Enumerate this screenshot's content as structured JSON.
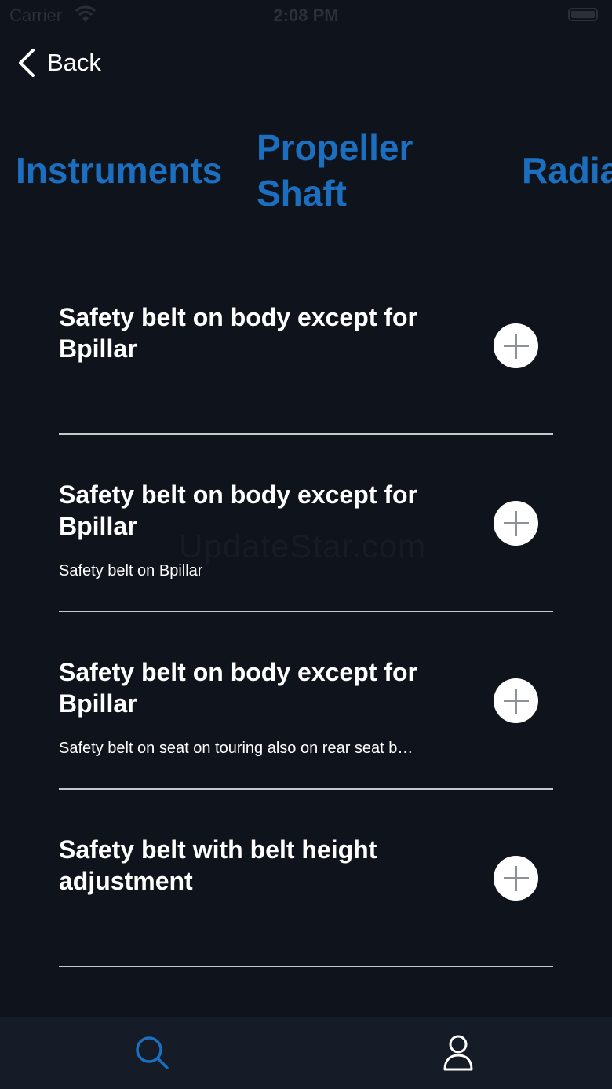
{
  "status_bar": {
    "carrier": "Carrier",
    "time": "2:08 PM"
  },
  "nav": {
    "back_label": "Back"
  },
  "categories": [
    {
      "label": "Instruments"
    },
    {
      "label": "Propeller Shaft"
    },
    {
      "label": "Radia"
    }
  ],
  "items": [
    {
      "title": "Safety belt on body except for Bpillar",
      "subtitle": ""
    },
    {
      "title": "Safety belt on body except for Bpillar",
      "subtitle": "Safety belt on Bpillar"
    },
    {
      "title": "Safety belt on body except for Bpillar",
      "subtitle": "Safety belt on seat on touring also on rear seat b…"
    },
    {
      "title": "Safety belt with belt height adjustment",
      "subtitle": ""
    }
  ],
  "watermark": "UpdateStar.com",
  "tab_bar": {
    "tabs": [
      {
        "icon": "search-icon",
        "active": true
      },
      {
        "icon": "person-icon",
        "active": false
      }
    ]
  },
  "colors": {
    "background": "#0f131b",
    "accent": "#1c6fbf",
    "tab_bar": "#161c27"
  }
}
